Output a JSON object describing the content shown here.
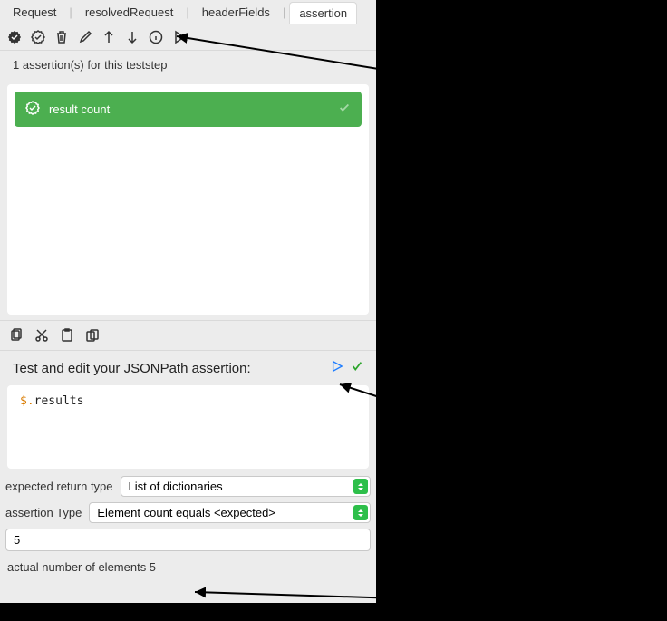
{
  "tabs": {
    "request": "Request",
    "resolvedRequest": "resolvedRequest",
    "headerFields": "headerFields",
    "assertion": "assertion",
    "active": "assertion"
  },
  "status": {
    "assertion_count_text": "1 assertion(s) for this teststep"
  },
  "assertions": [
    {
      "label": "result count",
      "status": "pass"
    }
  ],
  "jsonpath": {
    "header": "Test and edit your JSONPath assertion:",
    "expression_prefix": "$.",
    "expression_rest": "results"
  },
  "form": {
    "expected_return_type_label": "expected return type",
    "expected_return_type_value": "List of dictionaries",
    "assertion_type_label": "assertion Type",
    "assertion_type_value": "Element count equals <expected>",
    "expected_value": "5",
    "actual_result_text": "actual number of elements 5"
  }
}
